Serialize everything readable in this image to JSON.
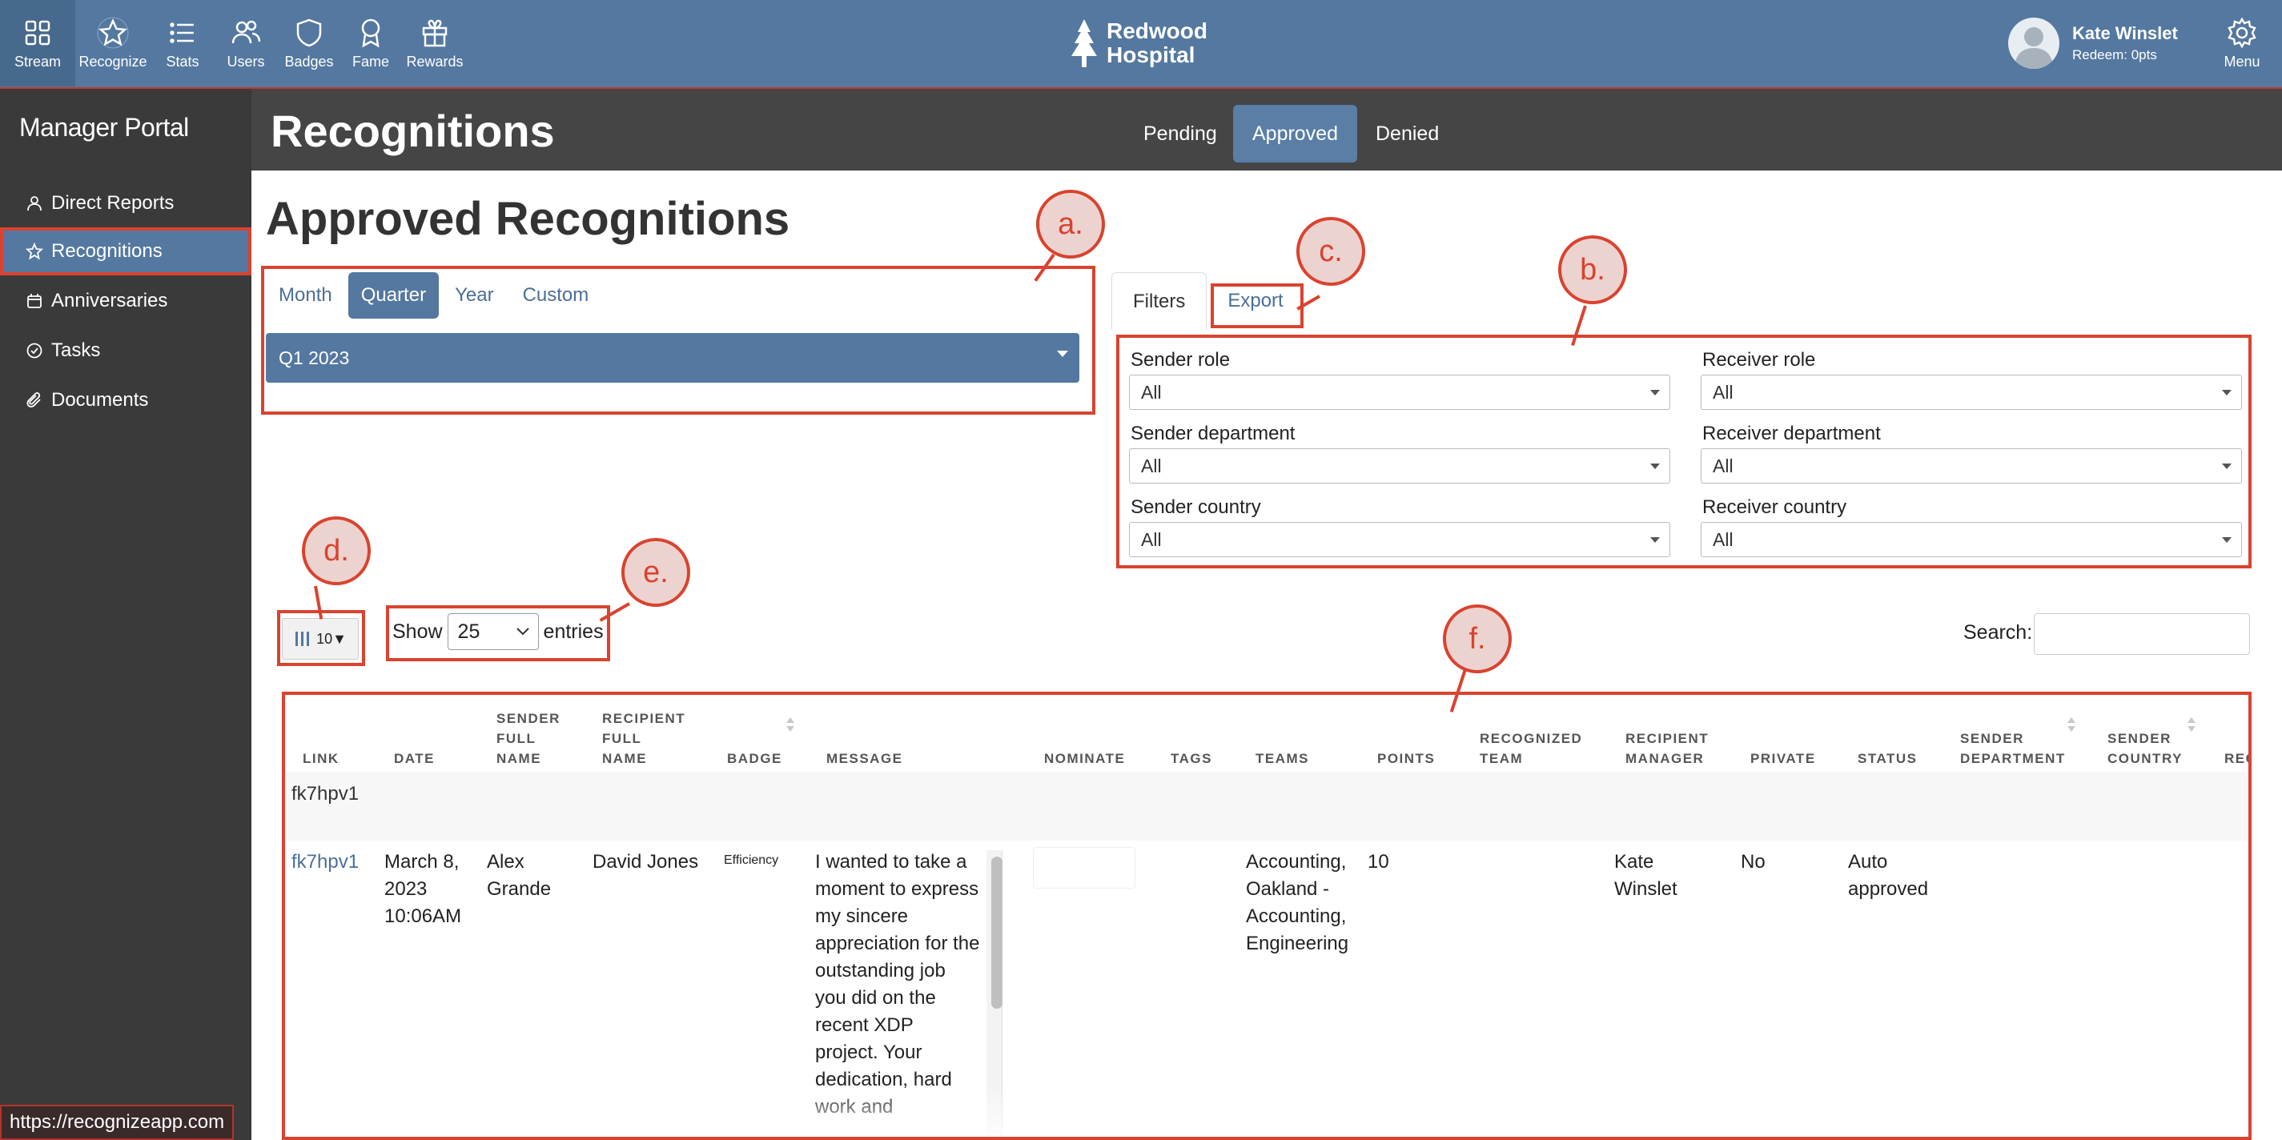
{
  "nav": {
    "items": [
      {
        "label": "Stream",
        "icon": "grid-icon"
      },
      {
        "label": "Recognize",
        "icon": "star-icon"
      },
      {
        "label": "Stats",
        "icon": "list-icon"
      },
      {
        "label": "Users",
        "icon": "users-icon"
      },
      {
        "label": "Badges",
        "icon": "shield-icon"
      },
      {
        "label": "Fame",
        "icon": "award-icon"
      },
      {
        "label": "Rewards",
        "icon": "gift-icon"
      }
    ],
    "logo_line1": "Redwood",
    "logo_line2": "Hospital",
    "user_name": "Kate Winslet",
    "user_redeem": "Redeem: 0pts",
    "menu_label": "Menu"
  },
  "sidebar": {
    "title": "Manager Portal",
    "items": [
      {
        "label": "Direct Reports",
        "icon": "person-icon"
      },
      {
        "label": "Recognitions",
        "icon": "star-icon"
      },
      {
        "label": "Anniversaries",
        "icon": "calendar-icon"
      },
      {
        "label": "Tasks",
        "icon": "check-circle-icon"
      },
      {
        "label": "Documents",
        "icon": "paperclip-icon"
      }
    ]
  },
  "header": {
    "title": "Recognitions",
    "tabs": [
      "Pending",
      "Approved",
      "Denied"
    ]
  },
  "main": {
    "section_title": "Approved Recognitions",
    "period_tabs": [
      "Month",
      "Quarter",
      "Year",
      "Custom"
    ],
    "period_value": "Q1 2023",
    "filter_tabs": [
      "Filters",
      "Export"
    ],
    "filters": [
      {
        "label": "Sender role",
        "value": "All"
      },
      {
        "label": "Receiver role",
        "value": "All"
      },
      {
        "label": "Sender department",
        "value": "All"
      },
      {
        "label": "Receiver department",
        "value": "All"
      },
      {
        "label": "Sender country",
        "value": "All"
      },
      {
        "label": "Receiver country",
        "value": "All"
      }
    ],
    "column_count": "10▼",
    "show_label": "Show",
    "entries_value": "25",
    "entries_label": "entries",
    "search_label": "Search:"
  },
  "table": {
    "headers": [
      "LINK",
      "DATE",
      "SENDER FULL NAME",
      "RECIPIENT FULL NAME",
      "BADGE",
      "MESSAGE",
      "NOMINATE",
      "TAGS",
      "TEAMS",
      "POINTS",
      "RECOGNIZED TEAM",
      "RECIPIENT MANAGER",
      "PRIVATE",
      "STATUS",
      "SENDER DEPARTMENT",
      "SENDER COUNTRY",
      "RECEIVER DEPARTMENT"
    ],
    "group_label": "fk7hpv1",
    "row": {
      "link": "fk7hpv1",
      "date": "March 8, 2023 10:06AM",
      "sender": "Alex Grande",
      "recipient": "David Jones",
      "badge": "Efficiency",
      "message": "I wanted to take a moment to express my sincere appreciation for the outstanding job you did on the recent XDP project. Your dedication, hard work and",
      "teams": "Accounting, Oakland - Accounting, Engineering",
      "points": "10",
      "manager": "Kate Winslet",
      "private": "No",
      "status": "Auto approved"
    }
  },
  "annotations": [
    "a.",
    "b.",
    "c.",
    "d.",
    "e.",
    "f."
  ],
  "status_url": "https://recognizeapp.com",
  "colors": {
    "nav": "#5478a0",
    "sidebar": "#3a3a3a",
    "header": "#454545",
    "accent": "#d9432f",
    "link": "#4a6f98"
  }
}
